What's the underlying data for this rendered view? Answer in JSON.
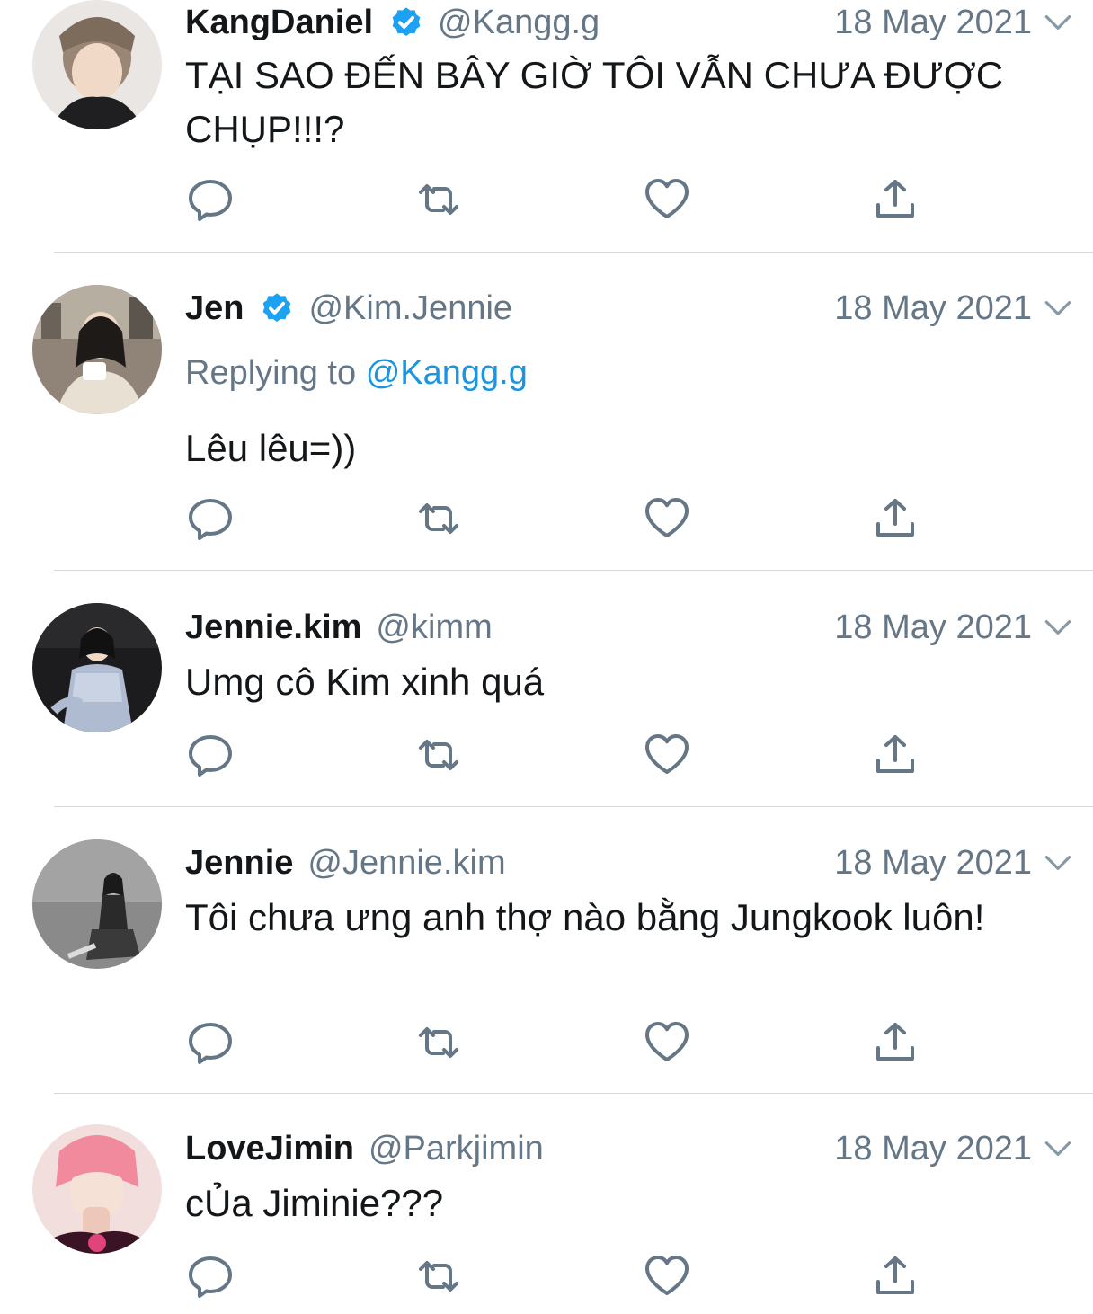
{
  "tweets": [
    {
      "name": "KangDaniel",
      "verified": true,
      "handle": "@Kangg.g",
      "date": "18 May 2021",
      "text": "TẠI SAO ĐẾN BÂY GIỜ TÔI VẪN CHƯA ĐƯỢC CHỤP!!!?",
      "avatar_icon": "avatar-photo"
    },
    {
      "name": "Jen",
      "verified": true,
      "handle": "@Kim.Jennie",
      "date": "18 May 2021",
      "replying_prefix": "Replying to",
      "replying_mention": "@Kangg.g",
      "text": "Lêu lêu=))",
      "avatar_icon": "avatar-photo"
    },
    {
      "name": "Jennie.kim",
      "verified": false,
      "handle": "@kimm",
      "date": "18 May 2021",
      "text": "Umg cô Kim xinh quá",
      "avatar_icon": "avatar-photo"
    },
    {
      "name": "Jennie",
      "verified": false,
      "handle": "@Jennie.kim",
      "date": "18 May 2021",
      "text": "Tôi chưa ưng anh thợ nào bằng Jungkook luôn!",
      "avatar_icon": "avatar-photo"
    },
    {
      "name": "LoveJimin",
      "verified": false,
      "handle": "@Parkjimin",
      "date": "18 May 2021",
      "text": "cỦa Jiminie???",
      "avatar_icon": "avatar-photo"
    }
  ],
  "action_icons": [
    "reply-icon",
    "retweet-icon",
    "like-icon",
    "share-icon"
  ],
  "colors": {
    "name": "#14171a",
    "secondary": "#657786",
    "link": "#1b95e0",
    "verified": "#1da1f2",
    "icon": "#657786",
    "divider": "#d5d9dc"
  }
}
